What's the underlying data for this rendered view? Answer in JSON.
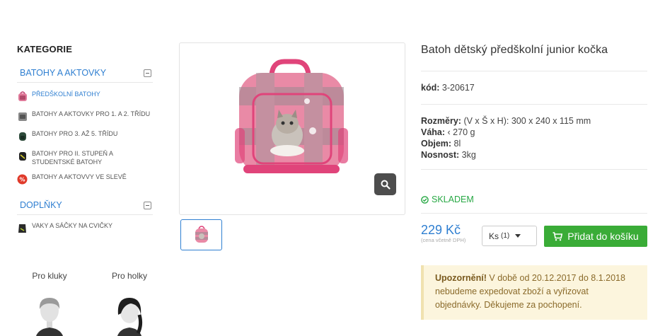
{
  "sidebar": {
    "heading": "KATEGORIE",
    "groups": [
      {
        "label": "BATOHY A AKTOVKY",
        "items": [
          {
            "label": "PŘEDŠKOLNÍ BATOHY",
            "active": true
          },
          {
            "label": "BATOHY A AKTOVKY PRO 1. A 2. TŘÍDU"
          },
          {
            "label": "BATOHY PRO 3. AŽ 5. TŘÍDU"
          },
          {
            "label": "BATOHY PRO II. STUPEŇ A STUDENTSKÉ BATOHY"
          },
          {
            "label": "BATOHY A AKTOVVY VE SLEVĚ"
          }
        ]
      },
      {
        "label": "DOPLŇKY",
        "items": [
          {
            "label": "VAKY A SÁČKY NA CVIČKY"
          }
        ]
      }
    ],
    "gender": {
      "boys": "Pro kluky",
      "girls": "Pro holky"
    }
  },
  "product": {
    "title": "Batoh dětský předškolní junior kočka",
    "code_label": "kód:",
    "code_value": "3-20617",
    "dims_label": "Rozměry:",
    "dims_value": "(V x Š x H): 300 x 240 x 115 mm",
    "weight_label": "Váha:",
    "weight_value": "‹ 270 g",
    "volume_label": "Objem:",
    "volume_value": "8l",
    "load_label": "Nosnost:",
    "load_value": "3kg",
    "stock": "SKLADEM",
    "price": "229 Kč",
    "price_note": "(cena včetně DPH)",
    "qty_label": "Ks",
    "qty_value": "(1)",
    "cart_button": "Přidat do košíku",
    "notice_bold": "Upozornění!",
    "notice_text": " V době od 20.12.2017 do 8.1.2018 nebudeme expedovat zboží a vyřizovat objednávky. Děkujeme za pochopení."
  },
  "colors": {
    "accent": "#2f7fd1",
    "cart": "#3aac37",
    "stock": "#27a844",
    "notice_bg": "#fcf5dd"
  },
  "icons": [
    "backpack-icon",
    "minus-square-icon",
    "search-icon",
    "cart-icon",
    "check-circle-icon",
    "caret-down-icon",
    "sale-badge-icon",
    "boy-avatar-icon",
    "girl-avatar-icon"
  ]
}
